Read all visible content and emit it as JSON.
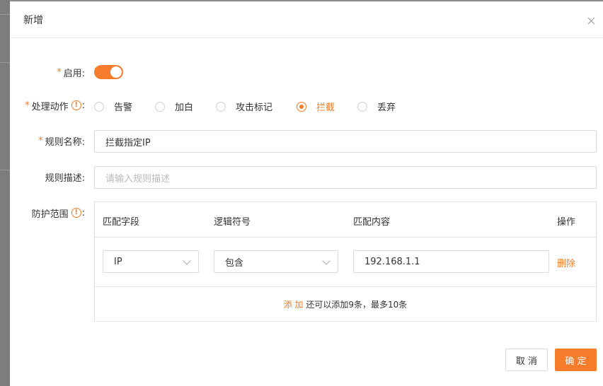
{
  "dialog": {
    "title": "新增",
    "close_icon": "close-icon"
  },
  "form": {
    "enable": {
      "label": "启用:",
      "on": true
    },
    "action": {
      "label": "处理动作",
      "options": [
        "告警",
        "加白",
        "攻击标记",
        "拦截",
        "丢弃"
      ],
      "selected": "拦截"
    },
    "rule_name": {
      "label": "规则名称:",
      "value": "拦截指定IP"
    },
    "rule_desc": {
      "label": "规则描述:",
      "placeholder": "请输入规则描述"
    },
    "scope": {
      "label": "防护范围"
    }
  },
  "table": {
    "headers": [
      "匹配字段",
      "逻辑符号",
      "匹配内容",
      "操作"
    ],
    "rows": [
      {
        "field": "IP",
        "operator": "包含",
        "content": "192.168.1.1",
        "action": "删除"
      }
    ],
    "add_link": "添 加",
    "add_hint": "还可以添加9条，最多10条"
  },
  "buttons": {
    "cancel": "取 消",
    "ok": "确 定"
  },
  "colors": {
    "accent": "#f47c2a"
  }
}
